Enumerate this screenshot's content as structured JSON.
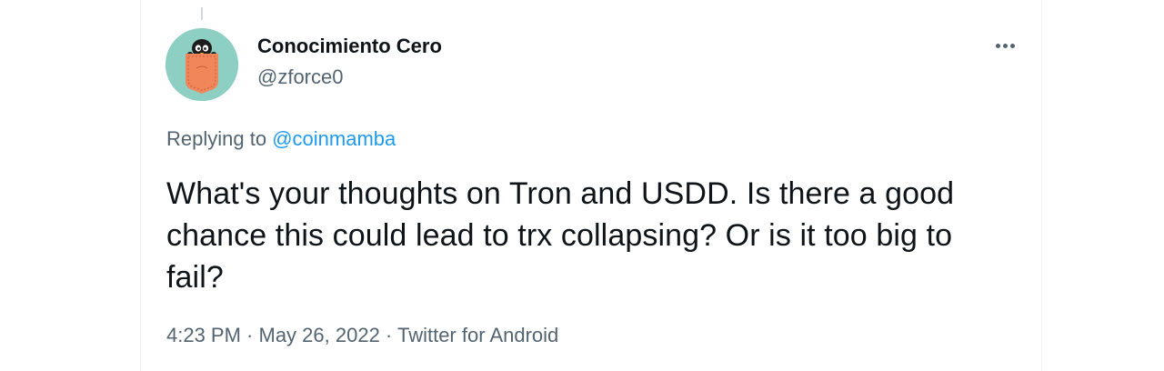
{
  "author": {
    "display_name": "Conocimiento Cero",
    "handle": "@zforce0",
    "avatar_icon": "penguin-in-pocket-avatar"
  },
  "more_icon": "more-horizontal-icon",
  "reply": {
    "prefix": "Replying to ",
    "mention": "@coinmamba"
  },
  "tweet": {
    "text": "What's your thoughts on Tron and USDD. Is there a good chance this could lead to trx collapsing? Or is it too big to fail?"
  },
  "meta": {
    "time": "4:23 PM",
    "separator": " · ",
    "date": "May 26, 2022",
    "source": "Twitter for Android"
  },
  "colors": {
    "text_primary": "#0f1419",
    "text_secondary": "#536471",
    "link": "#1d9bf0",
    "avatar_bg": "#8ecfc4",
    "pocket": "#f0865a"
  }
}
